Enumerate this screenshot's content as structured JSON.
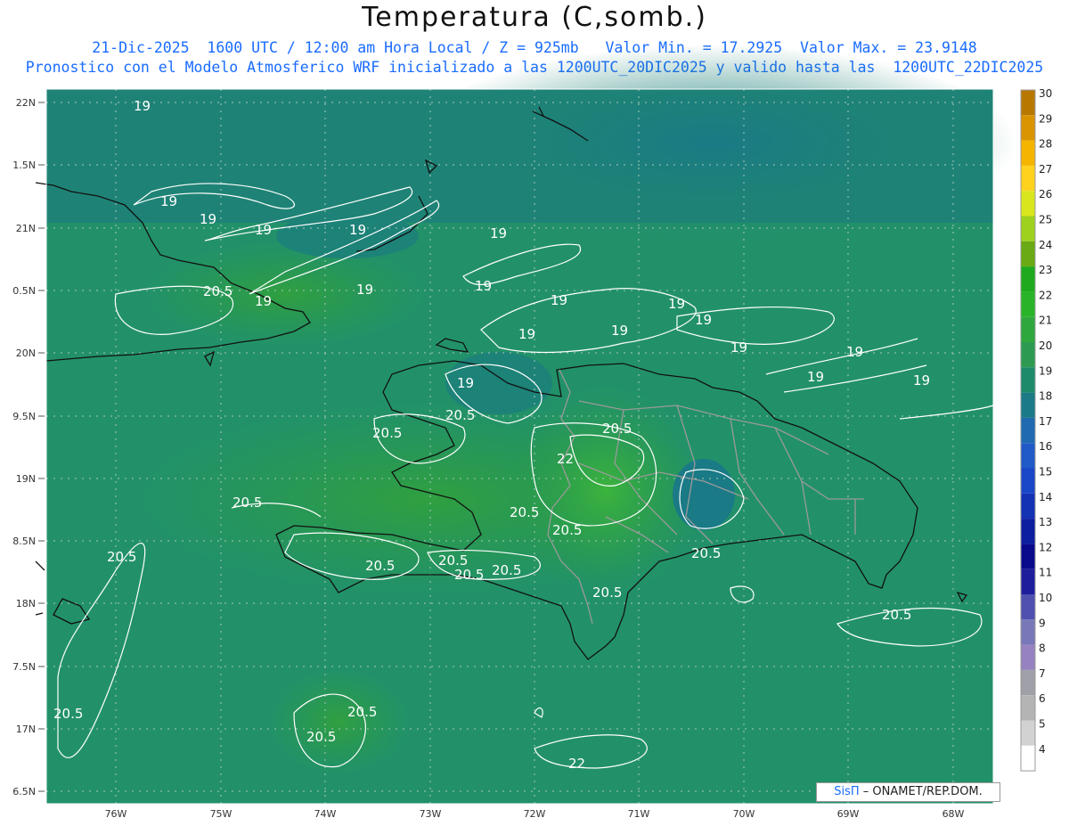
{
  "header": {
    "title": "Temperatura (C,somb.)",
    "line1": "21-Dic-2025  1600 UTC / 12:00 am Hora Local / Z = 925mb   Valor Min. = 17.2925  Valor Max. = 23.9148",
    "line2": "Pronostico con el Modelo Atmosferico WRF inicializado a las 1200UTC_20DIC2025 y valido hasta las  1200UTC_22DIC2025"
  },
  "map": {
    "lat_labels": [
      "22N",
      "1.5N",
      "21N",
      "0.5N",
      "20N",
      "9.5N",
      "19N",
      "8.5N",
      "18N",
      "7.5N",
      "17N",
      "6.5N"
    ],
    "lon_labels": [
      "76W",
      "75W",
      "74W",
      "73W",
      "72W",
      "71W",
      "70W",
      "69W",
      "68W"
    ],
    "contour_labels": [
      {
        "text": "19"
      },
      {
        "text": "19"
      },
      {
        "text": "19"
      },
      {
        "text": "19"
      },
      {
        "text": "19"
      },
      {
        "text": "19"
      },
      {
        "text": "19"
      },
      {
        "text": "19"
      },
      {
        "text": "19"
      },
      {
        "text": "19"
      },
      {
        "text": "19"
      },
      {
        "text": "19"
      },
      {
        "text": "19"
      },
      {
        "text": "19"
      },
      {
        "text": "19"
      },
      {
        "text": "19"
      },
      {
        "text": "19"
      },
      {
        "text": "19"
      },
      {
        "text": "19"
      },
      {
        "text": "20.5"
      },
      {
        "text": "20.5"
      },
      {
        "text": "20.5"
      },
      {
        "text": "20.5"
      },
      {
        "text": "20.5"
      },
      {
        "text": "20.5"
      },
      {
        "text": "20.5"
      },
      {
        "text": "20.5"
      },
      {
        "text": "20.5"
      },
      {
        "text": "20.5"
      },
      {
        "text": "20.5"
      },
      {
        "text": "20.5"
      },
      {
        "text": "20.5"
      },
      {
        "text": "20.5"
      },
      {
        "text": "20.5"
      },
      {
        "text": "20.5"
      },
      {
        "text": "20.5"
      },
      {
        "text": "20.5"
      },
      {
        "text": "22"
      },
      {
        "text": "22"
      }
    ]
  },
  "colorbar": {
    "values": [
      "30",
      "29",
      "28",
      "27",
      "26",
      "25",
      "24",
      "23",
      "22",
      "21",
      "20",
      "19",
      "18",
      "17",
      "16",
      "15",
      "14",
      "13",
      "12",
      "11",
      "10",
      "9",
      "8",
      "7",
      "6",
      "5",
      "4"
    ],
    "colors": [
      "#b87800",
      "#d99400",
      "#f5b400",
      "#ffd21e",
      "#d9e61e",
      "#9ed11e",
      "#6aaa14",
      "#1eaa1e",
      "#28b428",
      "#2ea83c",
      "#2c9a50",
      "#1d8a6a",
      "#1a7a86",
      "#1f6ab0",
      "#1f5ac8",
      "#1a46c8",
      "#1432b4",
      "#0e1ea0",
      "#0a0a8c",
      "#1e1e9c",
      "#5050b0",
      "#7878b8",
      "#9682c0",
      "#a0a0a8",
      "#b4b4b4",
      "#d2d2d2",
      "#ffffff"
    ]
  },
  "credit": {
    "sis": "SisΠ",
    "rest": " – ONAMET/REP.DOM."
  }
}
